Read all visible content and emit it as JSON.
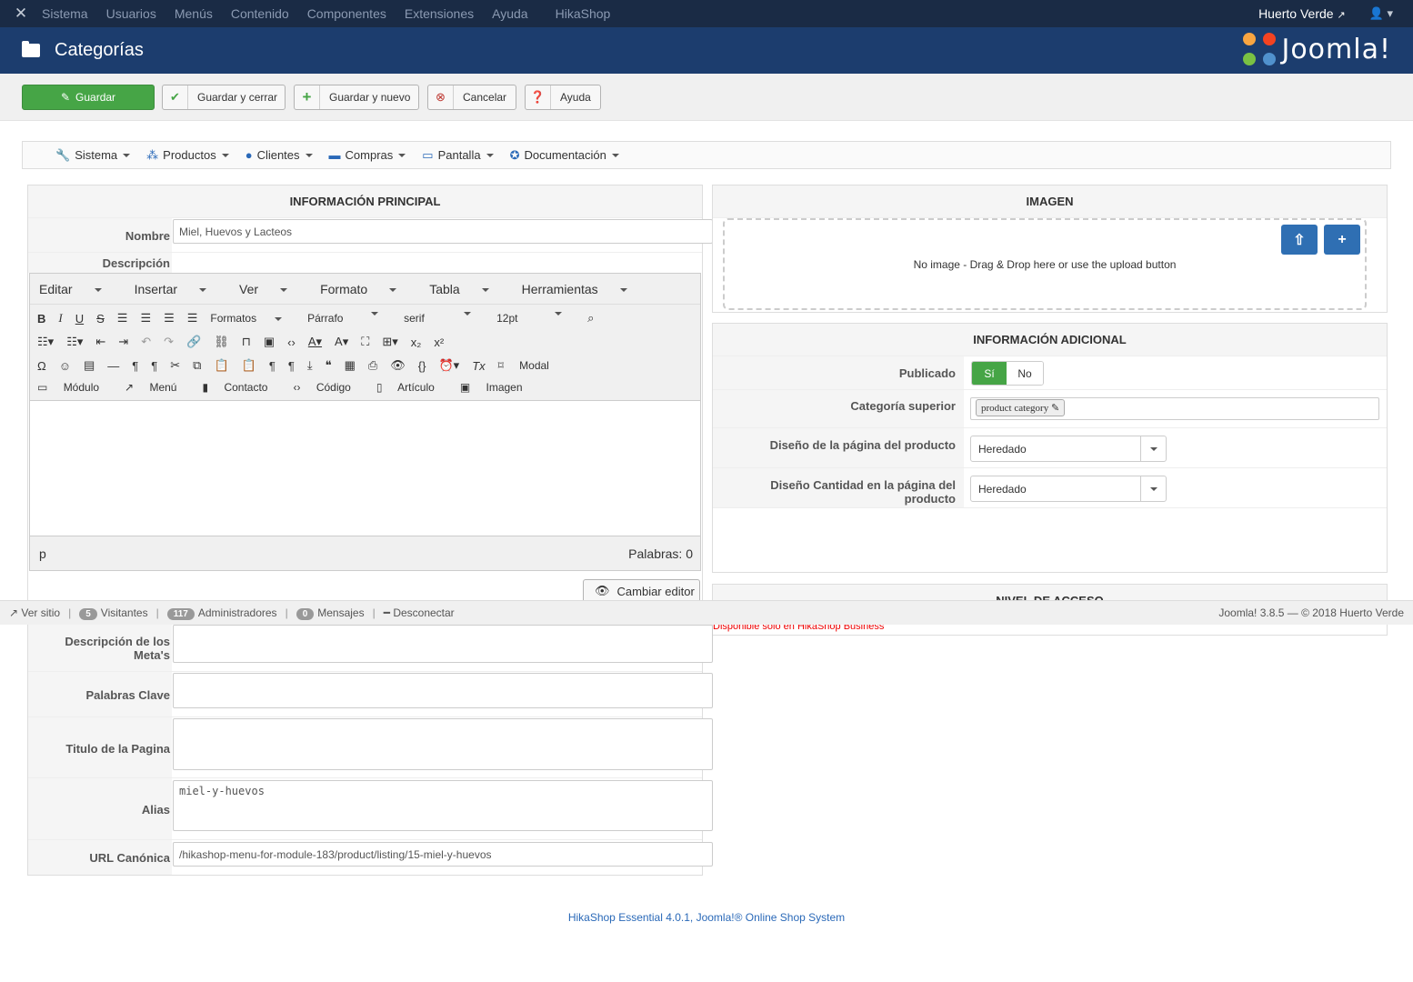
{
  "topnav": {
    "menu": [
      "Sistema",
      "Usuarios",
      "Menús",
      "Contenido",
      "Componentes",
      "Extensiones",
      "Ayuda",
      "HikaShop"
    ],
    "site_name": "Huerto Verde",
    "logo_icon": "joomla-logo-icon",
    "user_icon": "user-icon"
  },
  "header": {
    "title": "Categorías",
    "brand": "Joomla!"
  },
  "toolbar": {
    "save": "Guardar",
    "save_close": "Guardar y cerrar",
    "save_new": "Guardar y nuevo",
    "cancel": "Cancelar",
    "help": "Ayuda"
  },
  "hikamenu": [
    "Sistema",
    "Productos",
    "Clientes",
    "Compras",
    "Pantalla",
    "Documentación"
  ],
  "main_info": {
    "title": "INFORMACIÓN PRINCIPAL",
    "name_label": "Nombre",
    "name_value": "Miel, Huevos y Lacteos",
    "desc_label": "Descripción"
  },
  "editor": {
    "menus": [
      "Editar",
      "Insertar",
      "Ver",
      "Formato",
      "Tabla",
      "Herramientas"
    ],
    "formats": "Formatos",
    "block": "Párrafo",
    "font": "serif",
    "size": "12pt",
    "modal": "Modal",
    "buttons": [
      "Módulo",
      "Menú",
      "Contacto",
      "Código",
      "Artículo",
      "Imagen"
    ],
    "path": "p",
    "words": "Palabras: 0",
    "toggle": "Cambiar editor"
  },
  "image": {
    "title": "IMAGEN",
    "dropzone": "No image - Drag & Drop here or use the upload button"
  },
  "additional": {
    "title": "INFORMACIÓN ADICIONAL",
    "published_label": "Publicado",
    "yes": "Sí",
    "no": "No",
    "parent_label": "Categoría superior",
    "parent_value": "product category",
    "layout_label": "Diseño de la página del producto",
    "layout_value": "Heredado",
    "qty_label": "Diseño Cantidad en la página del producto",
    "qty_value": "Heredado"
  },
  "access": {
    "title": "NIVEL DE ACCESO",
    "note": "Disponible solo en HikaShop Business"
  },
  "meta": {
    "meta_desc_label": "Descripción de los Meta's",
    "keywords_label": "Palabras Clave",
    "page_title_label": "Titulo de la Pagina",
    "alias_label": "Alias",
    "alias_value": "miel-y-huevos",
    "canonical_label": "URL Canónica",
    "canonical_value": "/hikashop-menu-for-module-183/product/listing/15-miel-y-huevos"
  },
  "statusbar": {
    "view_site": "Ver sitio",
    "visitors_count": "5",
    "visitors": "Visitantes",
    "admins_count": "117",
    "admins": "Administradores",
    "messages_count": "0",
    "messages": "Mensajes",
    "logout": "Desconectar",
    "version": "Joomla! 3.8.5 — © 2018 Huerto Verde"
  },
  "footer": "HikaShop Essential 4.0.1, Joomla!® Online Shop System",
  "colors": {
    "navbar": "#1a2b45",
    "header": "#1c3d6e",
    "success": "#46a546",
    "primary": "#2f6fb3",
    "link": "#2a69b8"
  }
}
